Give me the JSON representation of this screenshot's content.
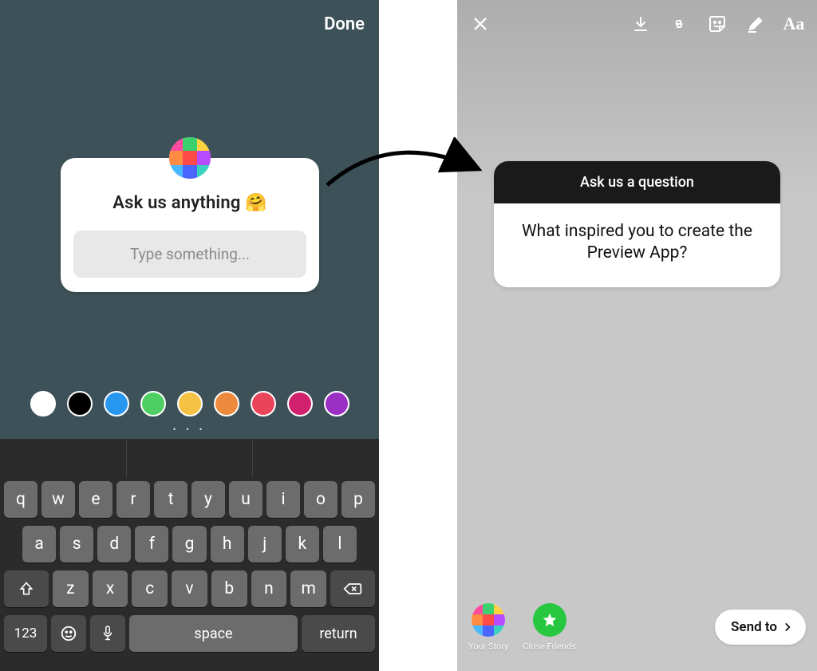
{
  "left": {
    "done_label": "Done",
    "question_card": {
      "prompt": "Ask us anything 🤗",
      "placeholder": "Type something..."
    },
    "swatches": [
      "#ffffff",
      "#000000",
      "#2897f0",
      "#4ecf63",
      "#f6c243",
      "#ec893c",
      "#e9445a",
      "#d1206e",
      "#9b2fc4"
    ],
    "page_dots": "• • •",
    "keyboard": {
      "row1": [
        "q",
        "w",
        "e",
        "r",
        "t",
        "y",
        "u",
        "i",
        "o",
        "p"
      ],
      "row2": [
        "a",
        "s",
        "d",
        "f",
        "g",
        "h",
        "j",
        "k",
        "l"
      ],
      "row3": [
        "z",
        "x",
        "c",
        "v",
        "b",
        "n",
        "m"
      ],
      "num_label": "123",
      "space_label": "space",
      "return_label": "return"
    }
  },
  "right": {
    "answer_card": {
      "header": "Ask us a question",
      "body": "What inspired you to create the Preview App?"
    },
    "bottom": {
      "your_story_label": "Your Story",
      "close_friends_label": "Close Friends",
      "send_to_label": "Send to"
    }
  }
}
